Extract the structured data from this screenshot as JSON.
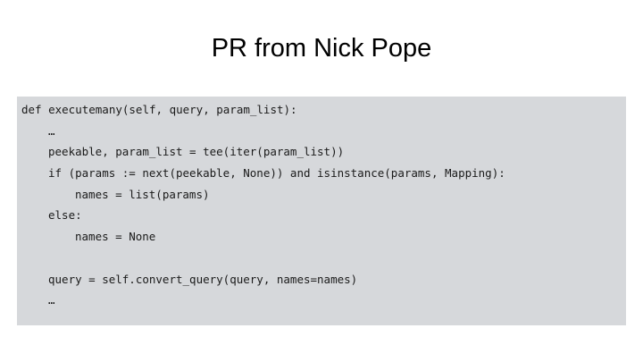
{
  "slide": {
    "title": "PR from Nick Pope",
    "code_lines": [
      {
        "indent": 0,
        "text": "def executemany(self, query, param_list):"
      },
      {
        "indent": 1,
        "text": "…"
      },
      {
        "indent": 1,
        "text": "peekable, param_list = tee(iter(param_list))"
      },
      {
        "indent": 1,
        "text": "if (params := next(peekable, None)) and isinstance(params, Mapping):"
      },
      {
        "indent": 2,
        "text": "names = list(params)"
      },
      {
        "indent": 1,
        "text": "else:"
      },
      {
        "indent": 2,
        "text": "names = None"
      },
      {
        "indent": 0,
        "text": ""
      },
      {
        "indent": 1,
        "text": "query = self.convert_query(query, names=names)"
      },
      {
        "indent": 1,
        "text": "…"
      }
    ]
  }
}
